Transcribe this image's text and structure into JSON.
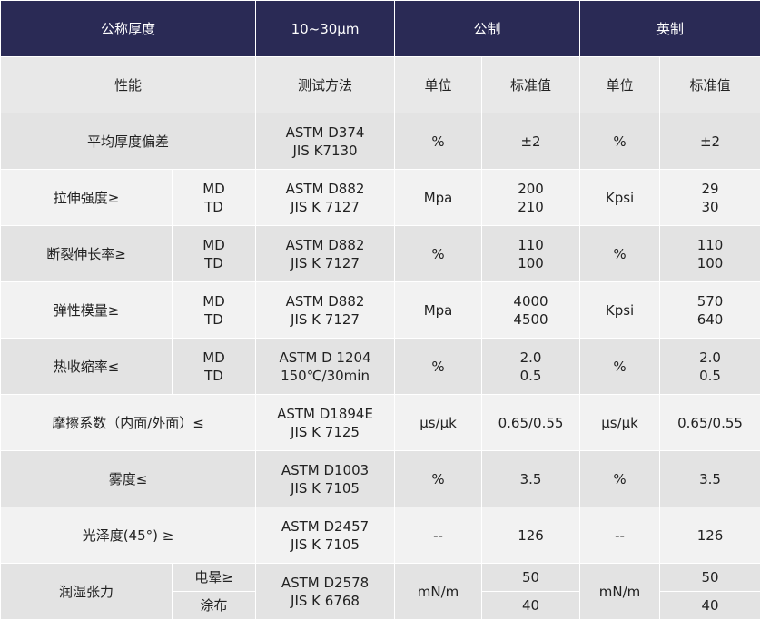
{
  "header": {
    "thickness_label": "公称厚度",
    "thickness_value": "10~30μm",
    "metric": "公制",
    "imperial": "英制"
  },
  "subheader": {
    "property": "性能",
    "test_method": "测试方法",
    "metric_unit": "单位",
    "metric_std": "标准值",
    "imperial_unit": "单位",
    "imperial_std": "标准值"
  },
  "rows": [
    {
      "property": "平均厚度偏差",
      "method": [
        "ASTM D374",
        "JIS K7130"
      ],
      "m_unit": "%",
      "m_val": [
        "±2"
      ],
      "i_unit": "%",
      "i_val": [
        "±2"
      ]
    },
    {
      "property": "拉伸强度≥",
      "dir": [
        "MD",
        "TD"
      ],
      "method": [
        "ASTM D882",
        "JIS K 7127"
      ],
      "m_unit": "Mpa",
      "m_val": [
        "200",
        "210"
      ],
      "i_unit": "Kpsi",
      "i_val": [
        "29",
        "30"
      ]
    },
    {
      "property": "断裂伸长率≥",
      "dir": [
        "MD",
        "TD"
      ],
      "method": [
        "ASTM D882",
        "JIS K 7127"
      ],
      "m_unit": "%",
      "m_val": [
        "110",
        "100"
      ],
      "i_unit": "%",
      "i_val": [
        "110",
        "100"
      ]
    },
    {
      "property": "弹性模量≥",
      "dir": [
        "MD",
        "TD"
      ],
      "method": [
        "ASTM D882",
        "JIS K 7127"
      ],
      "m_unit": "Mpa",
      "m_val": [
        "4000",
        "4500"
      ],
      "i_unit": "Kpsi",
      "i_val": [
        "570",
        "640"
      ]
    },
    {
      "property": "热收缩率≤",
      "dir": [
        "MD",
        "TD"
      ],
      "method": [
        "ASTM D 1204",
        "150℃/30min"
      ],
      "m_unit": "%",
      "m_val": [
        "2.0",
        "0.5"
      ],
      "i_unit": "%",
      "i_val": [
        "2.0",
        "0.5"
      ]
    },
    {
      "property": "摩擦系数（内面/外面）≤",
      "method": [
        "ASTM D1894E",
        "JIS K 7125"
      ],
      "m_unit": "μs/μk",
      "m_val": [
        "0.65/0.55"
      ],
      "i_unit": "μs/μk",
      "i_val": [
        "0.65/0.55"
      ]
    },
    {
      "property": "雾度≤",
      "method": [
        "ASTM D1003",
        "JIS K 7105"
      ],
      "m_unit": "%",
      "m_val": [
        "3.5"
      ],
      "i_unit": "%",
      "i_val": [
        "3.5"
      ]
    },
    {
      "property": "光泽度(45°) ≥",
      "method": [
        "ASTM D2457",
        "JIS K 7105"
      ],
      "m_unit": "--",
      "m_val": [
        "126"
      ],
      "i_unit": "--",
      "i_val": [
        "126"
      ]
    },
    {
      "property": "润湿张力",
      "dir": [
        "电晕≥",
        "涂布"
      ],
      "method": [
        "ASTM D2578",
        "JIS K 6768"
      ],
      "m_unit": "mN/m",
      "m_val": [
        "50",
        "40"
      ],
      "i_unit": "mN/m",
      "i_val": [
        "50",
        "40"
      ]
    }
  ]
}
